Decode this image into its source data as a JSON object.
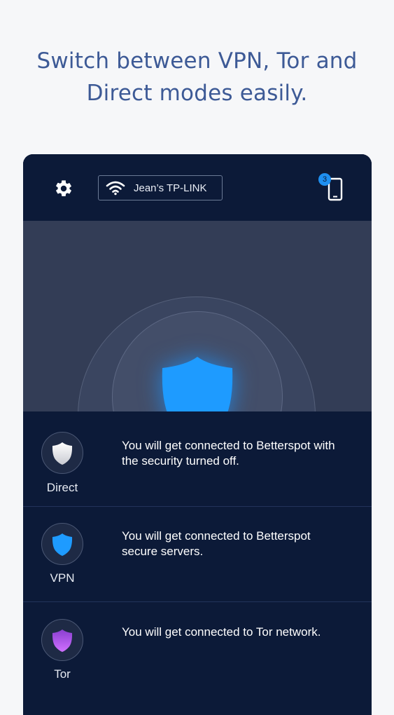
{
  "headline": {
    "line1": "Switch between VPN, Tor and",
    "line2": "Direct modes easily."
  },
  "topbar": {
    "settings_icon": "gear-icon",
    "network_icon": "wifi-icon",
    "network_name": "Jean’s TP-LINK",
    "device_icon": "phone-icon",
    "device_count": "3"
  },
  "status": {
    "shield_icon": "shield-icon",
    "shield_color": "#1e9bff"
  },
  "modes": [
    {
      "label": "Direct",
      "description": "You will get connected to Betterspot with the security turned off.",
      "icon": "shield-icon",
      "color": "#ffffff"
    },
    {
      "label": "VPN",
      "description": "You will get connected to Betterspot secure servers.",
      "icon": "shield-icon",
      "color": "#1e9bff"
    },
    {
      "label": "Tor",
      "description": "You will get connected to Tor network.",
      "icon": "shield-icon",
      "color": "#b04de6"
    }
  ],
  "colors": {
    "headline": "#3d5a96",
    "app_background": "#0c1a38",
    "accent": "#1e8ff0"
  }
}
